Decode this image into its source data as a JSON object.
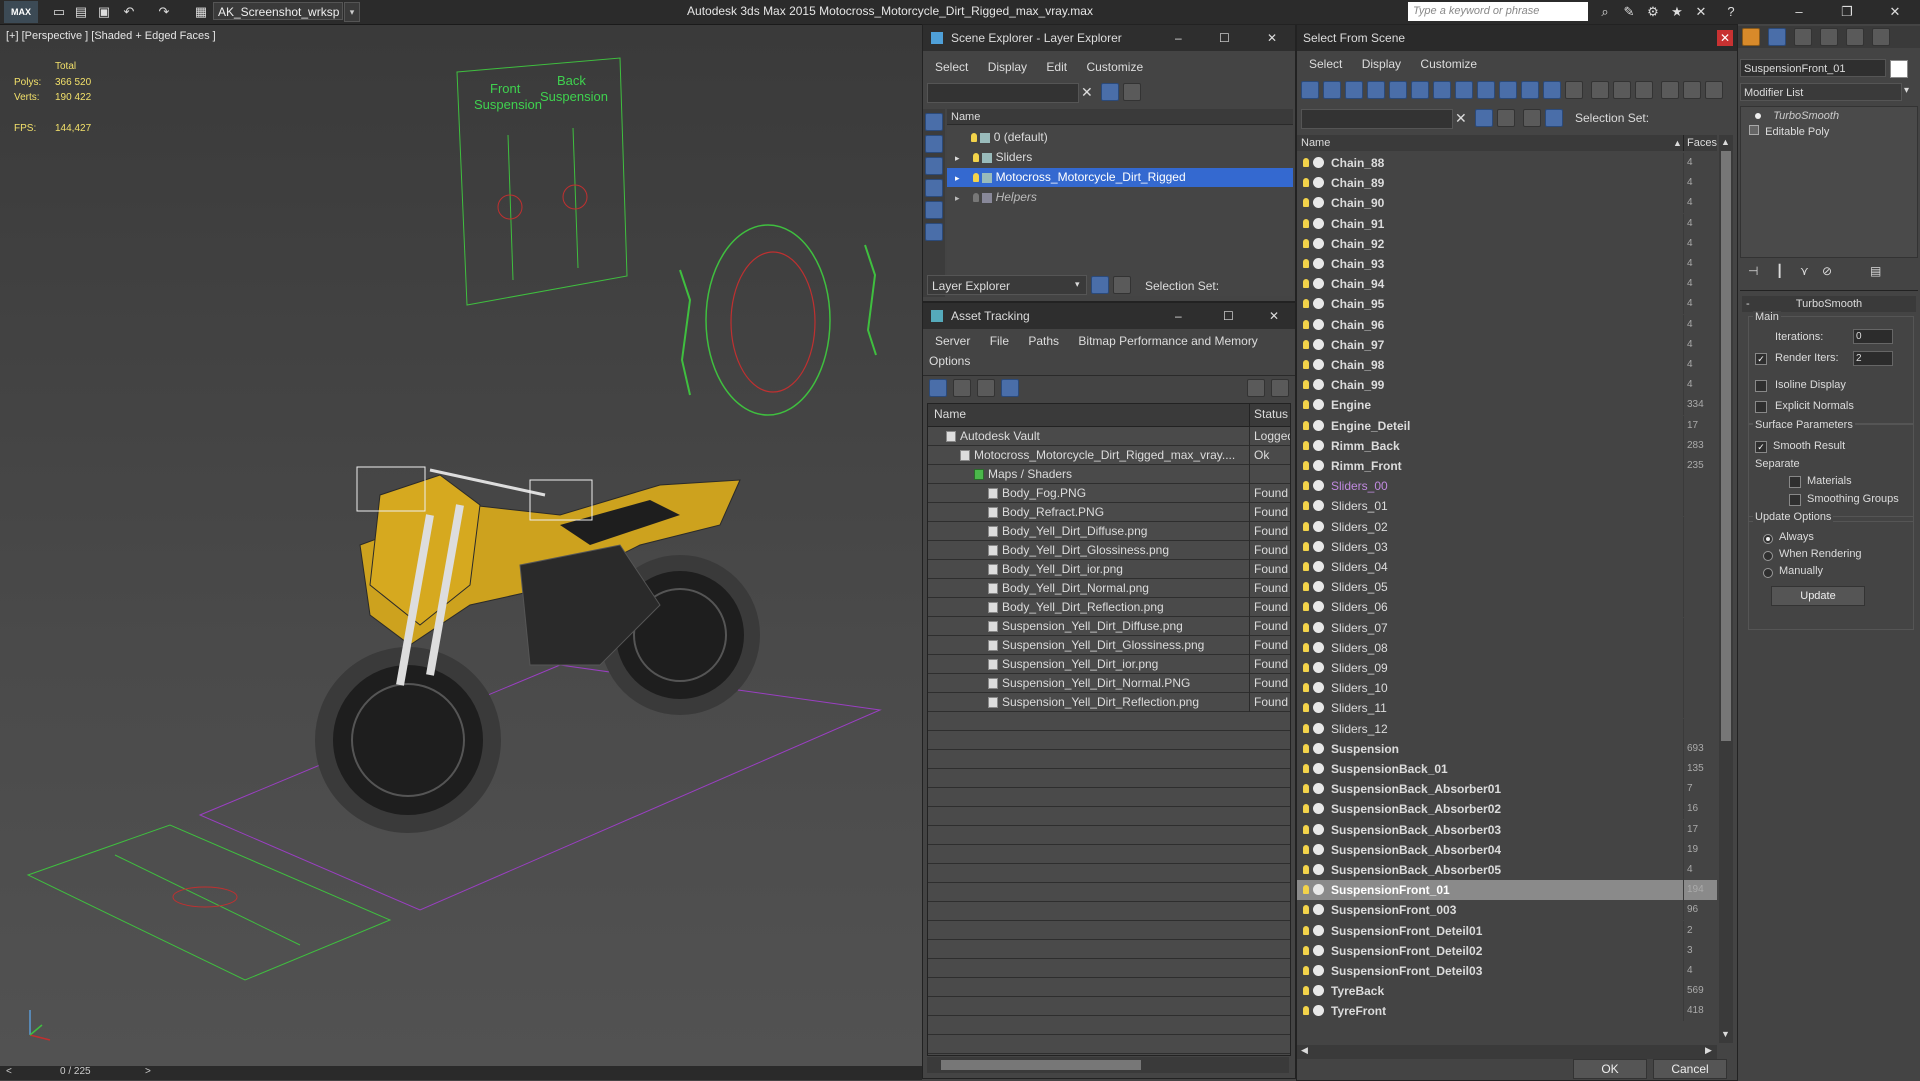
{
  "app": {
    "title": "Autodesk 3ds Max  2015     Motocross_Motorcycle_Dirt_Rigged_max_vray.max",
    "logo": "MAX",
    "workspace": "AK_Screenshot_wrksp",
    "search_placeholder": "Type a keyword or phrase"
  },
  "viewport": {
    "label": "[+] [Perspective ] [Shaded + Edged Faces ]",
    "stats": {
      "total_label": "Total",
      "polys_label": "Polys:",
      "polys_value": "366 520",
      "verts_label": "Verts:",
      "verts_value": "190 422",
      "fps_label": "FPS:",
      "fps_value": "144,427"
    },
    "scene_text": {
      "front": "Front\nSuspension",
      "back": "Back\nSuspension"
    },
    "frame_counter": "0 / 225"
  },
  "scene_explorer": {
    "title": "Scene Explorer - Layer Explorer",
    "menu": [
      "Select",
      "Display",
      "Edit",
      "Customize"
    ],
    "column": "Name",
    "layers": [
      {
        "name": "0 (default)",
        "selected": false,
        "italic": false,
        "expand": false
      },
      {
        "name": "Sliders",
        "selected": false,
        "italic": false,
        "expand": true
      },
      {
        "name": "Motocross_Motorcycle_Dirt_Rigged",
        "selected": true,
        "italic": false,
        "expand": true
      },
      {
        "name": "Helpers",
        "selected": false,
        "italic": true,
        "expand": true
      }
    ],
    "footer_dropdown": "Layer Explorer",
    "footer_selection_set": "Selection Set:"
  },
  "asset_tracking": {
    "title": "Asset Tracking",
    "menu": [
      "Server",
      "File",
      "Paths",
      "Bitmap Performance and Memory"
    ],
    "menu2": [
      "Options"
    ],
    "col_name": "Name",
    "col_status": "Status",
    "items": [
      {
        "name": "Autodesk Vault",
        "status": "Logged",
        "level": 0
      },
      {
        "name": "Motocross_Motorcycle_Dirt_Rigged_max_vray....",
        "status": "Ok",
        "level": 1
      },
      {
        "name": "Maps / Shaders",
        "status": "",
        "level": 2
      },
      {
        "name": "Body_Fog.PNG",
        "status": "Found",
        "level": 3
      },
      {
        "name": "Body_Refract.PNG",
        "status": "Found",
        "level": 3
      },
      {
        "name": "Body_Yell_Dirt_Diffuse.png",
        "status": "Found",
        "level": 3
      },
      {
        "name": "Body_Yell_Dirt_Glossiness.png",
        "status": "Found",
        "level": 3
      },
      {
        "name": "Body_Yell_Dirt_ior.png",
        "status": "Found",
        "level": 3
      },
      {
        "name": "Body_Yell_Dirt_Normal.png",
        "status": "Found",
        "level": 3
      },
      {
        "name": "Body_Yell_Dirt_Reflection.png",
        "status": "Found",
        "level": 3
      },
      {
        "name": "Suspension_Yell_Dirt_Diffuse.png",
        "status": "Found",
        "level": 3
      },
      {
        "name": "Suspension_Yell_Dirt_Glossiness.png",
        "status": "Found",
        "level": 3
      },
      {
        "name": "Suspension_Yell_Dirt_ior.png",
        "status": "Found",
        "level": 3
      },
      {
        "name": "Suspension_Yell_Dirt_Normal.PNG",
        "status": "Found",
        "level": 3
      },
      {
        "name": "Suspension_Yell_Dirt_Reflection.png",
        "status": "Found",
        "level": 3
      }
    ]
  },
  "select_from_scene": {
    "title": "Select From Scene",
    "menu": [
      "Select",
      "Display",
      "Customize"
    ],
    "selection_set": "Selection Set:",
    "col_name": "Name",
    "col_faces": "Faces",
    "ok": "OK",
    "cancel": "Cancel",
    "objects": [
      {
        "name": "Chain_88",
        "faces": "4",
        "style": "bold"
      },
      {
        "name": "Chain_89",
        "faces": "4",
        "style": "bold"
      },
      {
        "name": "Chain_90",
        "faces": "4",
        "style": "bold"
      },
      {
        "name": "Chain_91",
        "faces": "4",
        "style": "bold"
      },
      {
        "name": "Chain_92",
        "faces": "4",
        "style": "bold"
      },
      {
        "name": "Chain_93",
        "faces": "4",
        "style": "bold"
      },
      {
        "name": "Chain_94",
        "faces": "4",
        "style": "bold"
      },
      {
        "name": "Chain_95",
        "faces": "4",
        "style": "bold"
      },
      {
        "name": "Chain_96",
        "faces": "4",
        "style": "bold"
      },
      {
        "name": "Chain_97",
        "faces": "4",
        "style": "bold"
      },
      {
        "name": "Chain_98",
        "faces": "4",
        "style": "bold"
      },
      {
        "name": "Chain_99",
        "faces": "4",
        "style": "bold"
      },
      {
        "name": "Engine",
        "faces": "334",
        "style": "bold"
      },
      {
        "name": "Engine_Deteil",
        "faces": "17",
        "style": "bold"
      },
      {
        "name": "Rimm_Back",
        "faces": "283",
        "style": "bold"
      },
      {
        "name": "Rimm_Front",
        "faces": "235",
        "style": "bold"
      },
      {
        "name": "Sliders_00",
        "faces": "",
        "style": "purple"
      },
      {
        "name": "Sliders_01",
        "faces": "",
        "style": "normal"
      },
      {
        "name": "Sliders_02",
        "faces": "",
        "style": "normal"
      },
      {
        "name": "Sliders_03",
        "faces": "",
        "style": "normal"
      },
      {
        "name": "Sliders_04",
        "faces": "",
        "style": "normal"
      },
      {
        "name": "Sliders_05",
        "faces": "",
        "style": "normal"
      },
      {
        "name": "Sliders_06",
        "faces": "",
        "style": "normal"
      },
      {
        "name": "Sliders_07",
        "faces": "",
        "style": "normal"
      },
      {
        "name": "Sliders_08",
        "faces": "",
        "style": "normal"
      },
      {
        "name": "Sliders_09",
        "faces": "",
        "style": "normal"
      },
      {
        "name": "Sliders_10",
        "faces": "",
        "style": "normal"
      },
      {
        "name": "Sliders_11",
        "faces": "",
        "style": "normal"
      },
      {
        "name": "Sliders_12",
        "faces": "",
        "style": "normal"
      },
      {
        "name": "Suspension",
        "faces": "693",
        "style": "bold"
      },
      {
        "name": "SuspensionBack_01",
        "faces": "135",
        "style": "bold"
      },
      {
        "name": "SuspensionBack_Absorber01",
        "faces": "7",
        "style": "bold"
      },
      {
        "name": "SuspensionBack_Absorber02",
        "faces": "16",
        "style": "bold"
      },
      {
        "name": "SuspensionBack_Absorber03",
        "faces": "17",
        "style": "bold"
      },
      {
        "name": "SuspensionBack_Absorber04",
        "faces": "19",
        "style": "bold"
      },
      {
        "name": "SuspensionBack_Absorber05",
        "faces": "4",
        "style": "bold"
      },
      {
        "name": "SuspensionFront_01",
        "faces": "194",
        "style": "selected"
      },
      {
        "name": "SuspensionFront_003",
        "faces": "96",
        "style": "bold"
      },
      {
        "name": "SuspensionFront_Deteil01",
        "faces": "2",
        "style": "bold"
      },
      {
        "name": "SuspensionFront_Deteil02",
        "faces": "3",
        "style": "bold"
      },
      {
        "name": "SuspensionFront_Deteil03",
        "faces": "4",
        "style": "bold"
      },
      {
        "name": "TyreBack",
        "faces": "569",
        "style": "bold"
      },
      {
        "name": "TyreFront",
        "faces": "418",
        "style": "bold"
      }
    ]
  },
  "command_panel": {
    "object_name": "SuspensionFront_01",
    "modifier_list": "Modifier List",
    "stack": [
      "TurboSmooth",
      "Editable Poly"
    ],
    "rollout_title": "TurboSmooth",
    "main_label": "Main",
    "iterations_label": "Iterations:",
    "iterations_value": "0",
    "render_iters_label": "Render Iters:",
    "render_iters_value": "2",
    "isoline_label": "Isoline Display",
    "explicit_normals_label": "Explicit Normals",
    "surface_params_label": "Surface Parameters",
    "smooth_result_label": "Smooth Result",
    "separate_label": "Separate",
    "materials_label": "Materials",
    "smoothing_groups_label": "Smoothing Groups",
    "update_options_label": "Update Options",
    "always_label": "Always",
    "when_rendering_label": "When Rendering",
    "manually_label": "Manually",
    "update_button": "Update"
  }
}
